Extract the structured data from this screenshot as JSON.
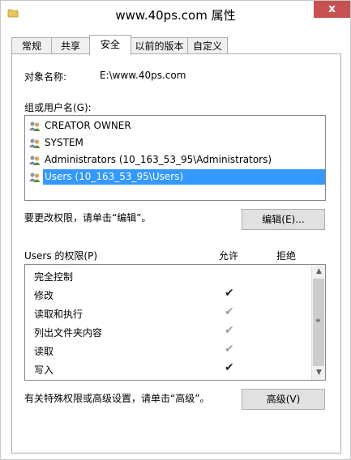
{
  "window": {
    "title": "www.40ps.com 属性",
    "close_glyph": "x"
  },
  "tabs": [
    {
      "label": "常规"
    },
    {
      "label": "共享"
    },
    {
      "label": "安全"
    },
    {
      "label": "以前的版本"
    },
    {
      "label": "自定义"
    }
  ],
  "security": {
    "object_name_label": "对象名称:",
    "object_name_value": "E:\\www.40ps.com",
    "groups_label": "组或用户名(G):",
    "users": [
      {
        "name": "CREATOR OWNER",
        "selected": false
      },
      {
        "name": "SYSTEM",
        "selected": false
      },
      {
        "name": "Administrators (10_163_53_95\\Administrators)",
        "selected": false
      },
      {
        "name": "Users (10_163_53_95\\Users)",
        "selected": true
      }
    ],
    "change_hint": "要更改权限，请单击“编辑”。",
    "edit_button": "编辑(E)...",
    "permissions_label": "Users 的权限(P)",
    "allow_header": "允许",
    "deny_header": "拒绝",
    "permissions": [
      {
        "name": "完全控制",
        "allow": "",
        "allow_style": "none"
      },
      {
        "name": "修改",
        "allow": "✔",
        "allow_style": "dark"
      },
      {
        "name": "读取和执行",
        "allow": "✔",
        "allow_style": "gray"
      },
      {
        "name": "列出文件夹内容",
        "allow": "✔",
        "allow_style": "gray"
      },
      {
        "name": "读取",
        "allow": "✔",
        "allow_style": "gray"
      },
      {
        "name": "写入",
        "allow": "✔",
        "allow_style": "dark"
      }
    ],
    "advanced_hint": "有关特殊权限或高级设置，请单击“高级”。",
    "advanced_button": "高级(V)"
  },
  "colors": {
    "selection": "#3399ff",
    "close": "#c75050",
    "folder": "#e8c65a"
  }
}
